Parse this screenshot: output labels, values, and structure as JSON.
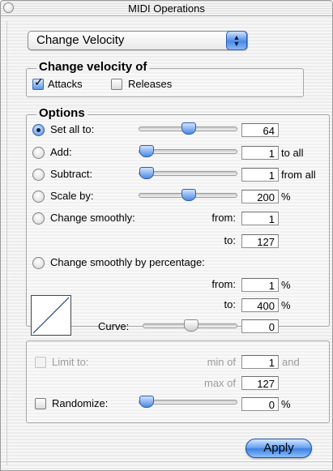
{
  "window": {
    "title": "MIDI Operations"
  },
  "operation_popup": {
    "selected": "Change Velocity"
  },
  "change_velocity_group": {
    "title": "Change velocity of",
    "attacks": {
      "label": "Attacks",
      "checked": true
    },
    "releases": {
      "label": "Releases",
      "checked": false
    }
  },
  "options": {
    "title": "Options",
    "set_all": {
      "label": "Set all to:",
      "value": "64",
      "selected": true,
      "slider": 0.5
    },
    "add": {
      "label": "Add:",
      "value": "1",
      "suffix": "to all",
      "slider": 0.0
    },
    "subtract": {
      "label": "Subtract:",
      "value": "1",
      "suffix": "from all",
      "slider": 0.0
    },
    "scale": {
      "label": "Scale by:",
      "value": "200",
      "suffix": "%",
      "slider": 0.5
    },
    "change_smoothly": {
      "label": "Change smoothly:",
      "from_label": "from:",
      "from_value": "1",
      "to_label": "to:",
      "to_value": "127"
    },
    "change_smoothly_pct": {
      "label": "Change smoothly by percentage:",
      "from_label": "from:",
      "from_value": "1",
      "from_suffix": "%",
      "to_label": "to:",
      "to_value": "400",
      "to_suffix": "%",
      "curve_label": "Curve:",
      "curve_value": "0",
      "curve_slider": 0.5
    }
  },
  "limit_group": {
    "limit": {
      "label": "Limit to:",
      "checked": false,
      "enabled": false
    },
    "min_label": "min of",
    "min_value": "1",
    "and_label": "and",
    "max_label": "max of",
    "max_value": "127",
    "randomize": {
      "label": "Randomize:",
      "checked": false,
      "value": "0",
      "suffix": "%",
      "slider": 0.0
    }
  },
  "apply_button": {
    "label": "Apply"
  },
  "colors": {
    "accent": "#4a8ae6",
    "window_bg": "#efefef"
  }
}
